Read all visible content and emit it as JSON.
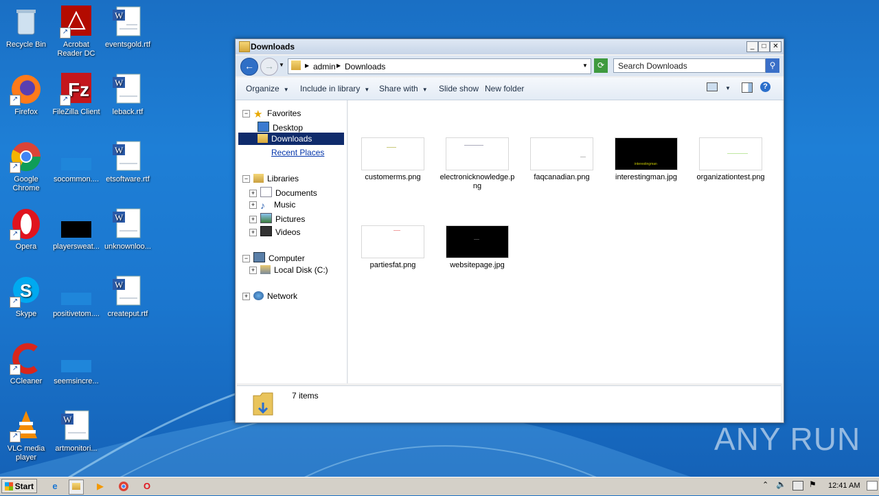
{
  "desktop": {
    "icons": [
      {
        "label": "Recycle Bin"
      },
      {
        "label": "Acrobat Reader DC"
      },
      {
        "label": "eventsgold.rtf"
      },
      {
        "label": "Firefox"
      },
      {
        "label": "FileZilla Client"
      },
      {
        "label": "leback.rtf"
      },
      {
        "label": "Google Chrome"
      },
      {
        "label": "socommon...."
      },
      {
        "label": "etsoftware.rtf"
      },
      {
        "label": "Opera"
      },
      {
        "label": "playersweat..."
      },
      {
        "label": "unknownloo..."
      },
      {
        "label": "Skype"
      },
      {
        "label": "positivetom...."
      },
      {
        "label": "createput.rtf"
      },
      {
        "label": "CCleaner"
      },
      {
        "label": "seemsincre..."
      },
      {
        "label": "VLC media player"
      },
      {
        "label": "artmonitori..."
      }
    ]
  },
  "window": {
    "title": "Downloads",
    "address": {
      "segments": [
        "admin",
        "Downloads"
      ]
    },
    "search_placeholder": "Search Downloads",
    "toolbar": {
      "organize": "Organize",
      "include_in_library": "Include in library",
      "share_with": "Share with",
      "slide_show": "Slide show",
      "new_folder": "New folder"
    },
    "nav": {
      "favorites": "Favorites",
      "desktop": "Desktop",
      "downloads": "Downloads",
      "recent_places": "Recent Places",
      "libraries": "Libraries",
      "documents": "Documents",
      "music": "Music",
      "pictures": "Pictures",
      "videos": "Videos",
      "computer": "Computer",
      "local_disk": "Local Disk (C:)",
      "network": "Network"
    },
    "files": [
      {
        "name": "customerms.png",
        "thumb": "light"
      },
      {
        "name": "electronicknowledge.png",
        "thumb": "light"
      },
      {
        "name": "faqcanadian.png",
        "thumb": "light"
      },
      {
        "name": "interestingman.jpg",
        "thumb": "dark",
        "caption": "interestingman"
      },
      {
        "name": "organizationtest.png",
        "thumb": "light"
      },
      {
        "name": "partiesfat.png",
        "thumb": "light"
      },
      {
        "name": "websitepage.jpg",
        "thumb": "dark"
      }
    ],
    "status": "7 items"
  },
  "taskbar": {
    "start": "Start",
    "clock": "12:41 AM"
  },
  "watermark": "ANY RUN",
  "colors": {
    "selection": "#0f2b6b",
    "desktop": "#1e7fd6"
  }
}
